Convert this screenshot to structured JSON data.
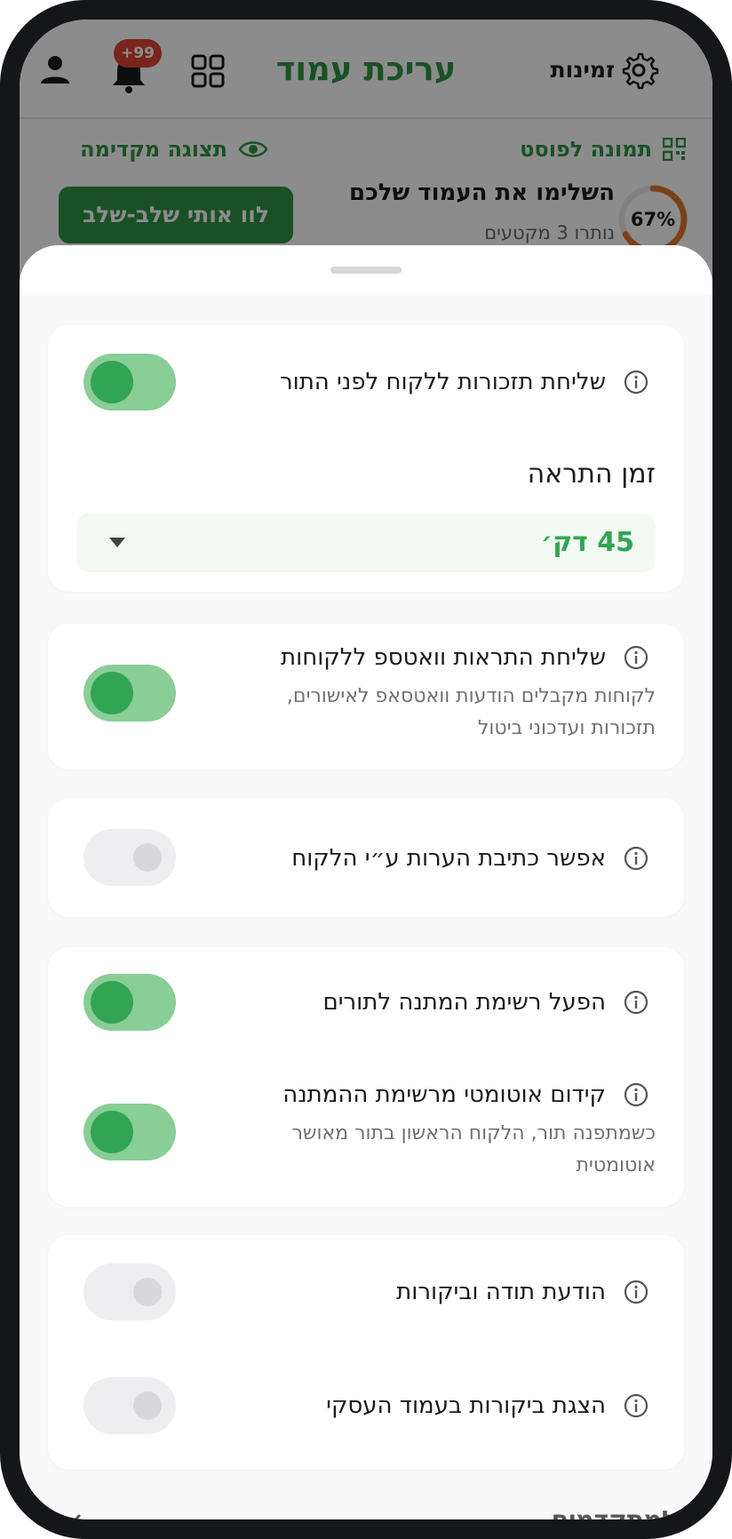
{
  "topbar": {
    "title": "עריכת עמוד",
    "settings_label": "זמינות",
    "notification_badge": "+99"
  },
  "page_links": {
    "photo_for_post": "תמונה לפוסט",
    "preview": "תצוגה מקדימה"
  },
  "completion": {
    "percent_label": "67%",
    "progress": 0.67,
    "title": "השלימו את העמוד שלכם",
    "subtitle": "נותרו 3 מקטעים",
    "guide_button": "לוו אותי שלב-שלב"
  },
  "colors": {
    "brand_green": "#2e9444",
    "toggle_on_track": "#89cd97",
    "toggle_on_knob": "#31a552",
    "toggle_off_track": "#eeeef0",
    "badge_red": "#e14338"
  },
  "settings": {
    "reminders": {
      "label": "שליחת תזכורות ללקוח לפני התור",
      "enabled": true
    },
    "reminder_time": {
      "title": "זמן התראה",
      "value": "45 דק׳"
    },
    "whatsapp": {
      "label": "שליחת התראות וואטספ ללקוחות",
      "description": "לקוחות מקבלים הודעות וואטסאפ לאישורים, תזכורות ועדכוני ביטול",
      "enabled": true
    },
    "client_notes": {
      "label": "אפשר כתיבת הערות ע״י הלקוח",
      "enabled": false
    },
    "waitlist": {
      "label": "הפעל רשימת המתנה לתורים",
      "enabled": true
    },
    "auto_promote": {
      "label": "קידום אוטומטי מרשימת ההמתנה",
      "description": "כשמתפנה תור, הלקוח הראשון בתור מאושר אוטומטית",
      "enabled": true
    },
    "thank_you_review": {
      "label": "הודעת תודה וביקורות",
      "enabled": false
    },
    "show_reviews": {
      "label": "הצגת ביקורות בעמוד העסקי",
      "enabled": false
    }
  },
  "advanced": {
    "label": "למתקדמים"
  }
}
